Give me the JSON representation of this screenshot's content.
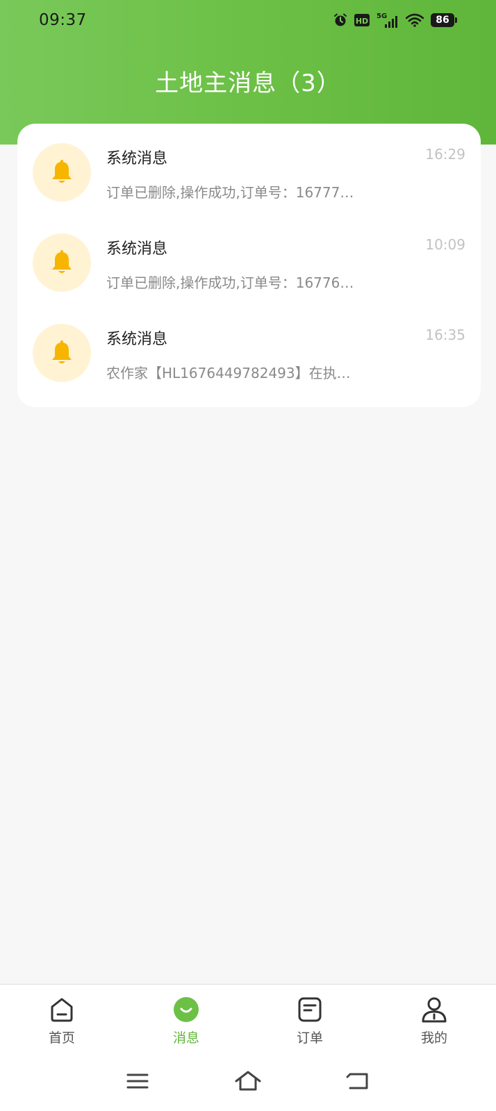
{
  "status_bar": {
    "time": "09:37",
    "network": "5G",
    "hd": "HD",
    "battery": "86",
    "icons": [
      "alarm-icon",
      "hd-icon",
      "signal-icon",
      "wifi-icon",
      "battery-icon"
    ]
  },
  "header": {
    "title": "土地主消息（3）"
  },
  "messages": [
    {
      "title": "系统消息",
      "time": "16:29",
      "preview": "订单已删除,操作成功,订单号：16777…",
      "icon": "bell-icon"
    },
    {
      "title": "系统消息",
      "time": "10:09",
      "preview": "订单已删除,操作成功,订单号：16776…",
      "icon": "bell-icon"
    },
    {
      "title": "系统消息",
      "time": "16:35",
      "preview": "农作家【HL1676449782493】在执…",
      "icon": "bell-icon"
    }
  ],
  "tabs": [
    {
      "label": "首页",
      "icon": "home-icon",
      "active": false
    },
    {
      "label": "消息",
      "icon": "message-icon",
      "active": true
    },
    {
      "label": "订单",
      "icon": "order-icon",
      "active": false
    },
    {
      "label": "我的",
      "icon": "profile-icon",
      "active": false
    }
  ],
  "colors": {
    "brand_green": "#6cc046",
    "bell_yellow": "#f7b500",
    "bell_bg": "#fff3d4"
  }
}
